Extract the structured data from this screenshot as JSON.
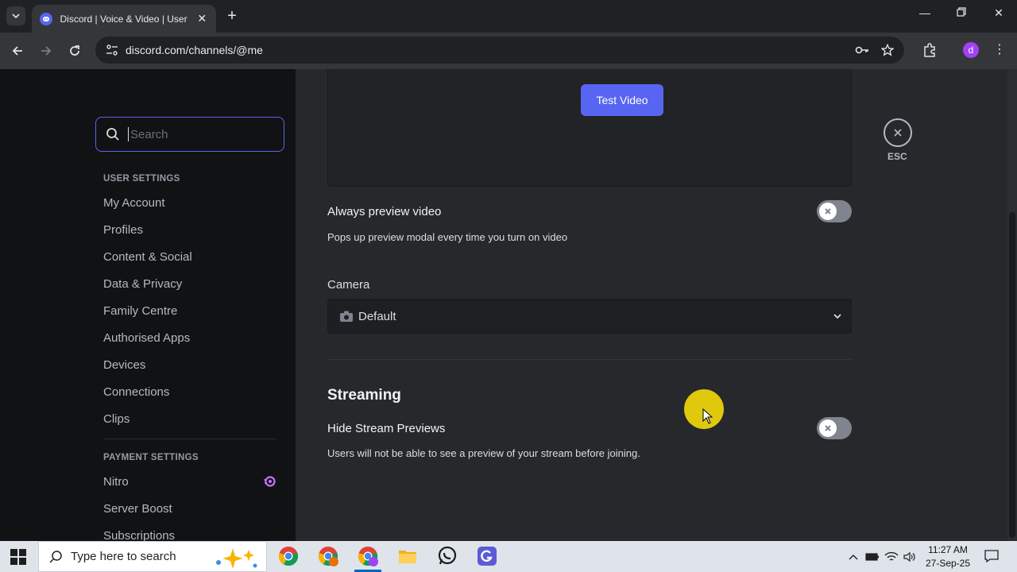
{
  "browser": {
    "tab_title": "Discord | Voice & Video | User Settings",
    "url": "discord.com/channels/@me"
  },
  "sidebar": {
    "search_placeholder": "Search",
    "user_settings_heading": "USER SETTINGS",
    "user_items": [
      "My Account",
      "Profiles",
      "Content & Social",
      "Data & Privacy",
      "Family Centre",
      "Authorised Apps",
      "Devices",
      "Connections",
      "Clips"
    ],
    "payment_settings_heading": "PAYMENT SETTINGS",
    "payment_items": [
      "Nitro",
      "Server Boost",
      "Subscriptions"
    ]
  },
  "main": {
    "test_video_label": "Test Video",
    "always_preview_title": "Always preview video",
    "always_preview_desc": "Pops up preview modal every time you turn on video",
    "always_preview_enabled": false,
    "camera_label": "Camera",
    "camera_value": "Default",
    "streaming_title": "Streaming",
    "hide_stream_title": "Hide Stream Previews",
    "hide_stream_desc": "Users will not be able to see a preview of your stream before joining.",
    "hide_stream_enabled": false,
    "esc_label": "ESC"
  },
  "taskbar": {
    "search_placeholder": "Type here to search",
    "time": "11:27 AM",
    "date": "27-Sep-25"
  },
  "colors": {
    "blurple": "#5865f2",
    "cursor_highlight": "#f5d90a"
  }
}
